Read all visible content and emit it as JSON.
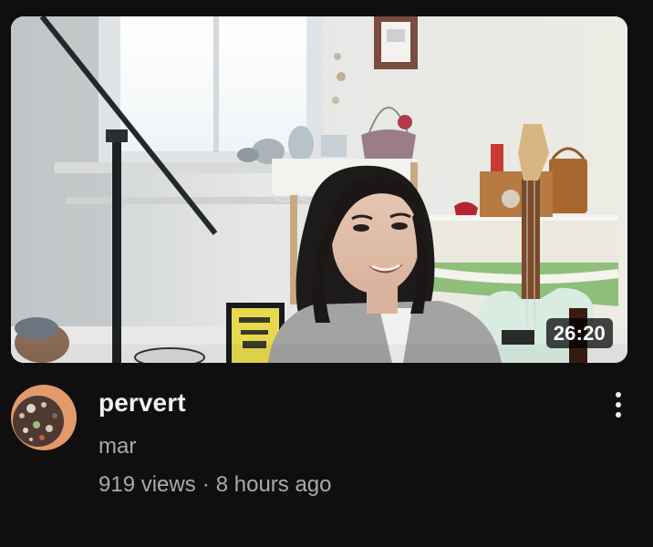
{
  "video": {
    "duration": "26:20",
    "title": "pervert",
    "channel": "mar",
    "views": "919 views",
    "separator": "·",
    "age": "8 hours ago"
  },
  "icons": {
    "more": "more-vert-icon",
    "avatar": "channel-avatar"
  },
  "colors": {
    "background": "#0f0f0f",
    "title": "#f1f1f1",
    "secondary_text": "#aaaaaa",
    "duration_badge": "#000000"
  }
}
